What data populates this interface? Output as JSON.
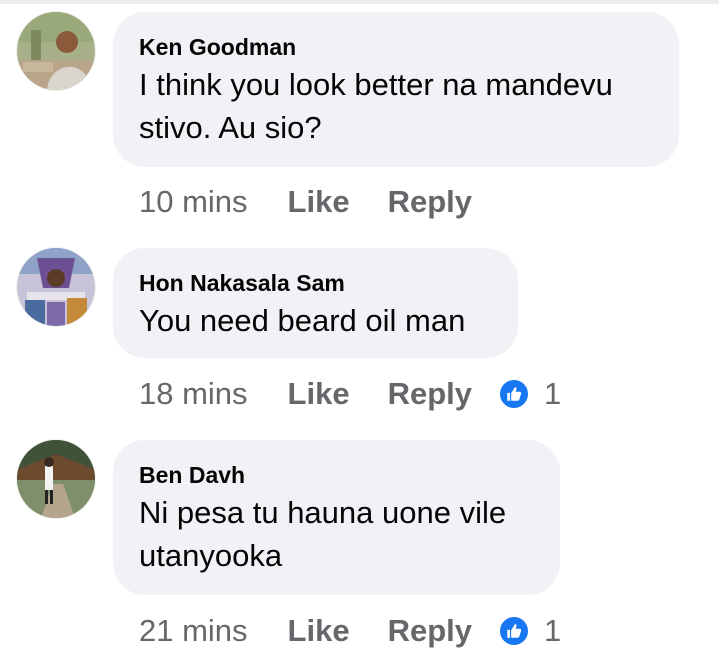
{
  "comments": [
    {
      "author": "Ken Goodman",
      "text_lines": [
        "I think you look better na mandevu",
        "stivo. Au sio?"
      ],
      "time": "10 mins",
      "like_label": "Like",
      "reply_label": "Reply",
      "reaction_count": ""
    },
    {
      "author": "Hon Nakasala Sam",
      "text_lines": [
        "You need beard oil man"
      ],
      "time": "18 mins",
      "like_label": "Like",
      "reply_label": "Reply",
      "reaction_count": "1",
      "reaction_icon": "thumbs-up-icon"
    },
    {
      "author": "Ben Davh",
      "text_lines": [
        "Ni pesa tu hauna uone vile",
        "utanyooka"
      ],
      "time": "21 mins",
      "like_label": "Like",
      "reply_label": "Reply",
      "reaction_count": "1",
      "reaction_icon": "thumbs-up-icon"
    }
  ],
  "colors": {
    "bubble_bg": "#f0f2f5",
    "meta_text": "#65676b",
    "like_badge": "#1877f2"
  }
}
